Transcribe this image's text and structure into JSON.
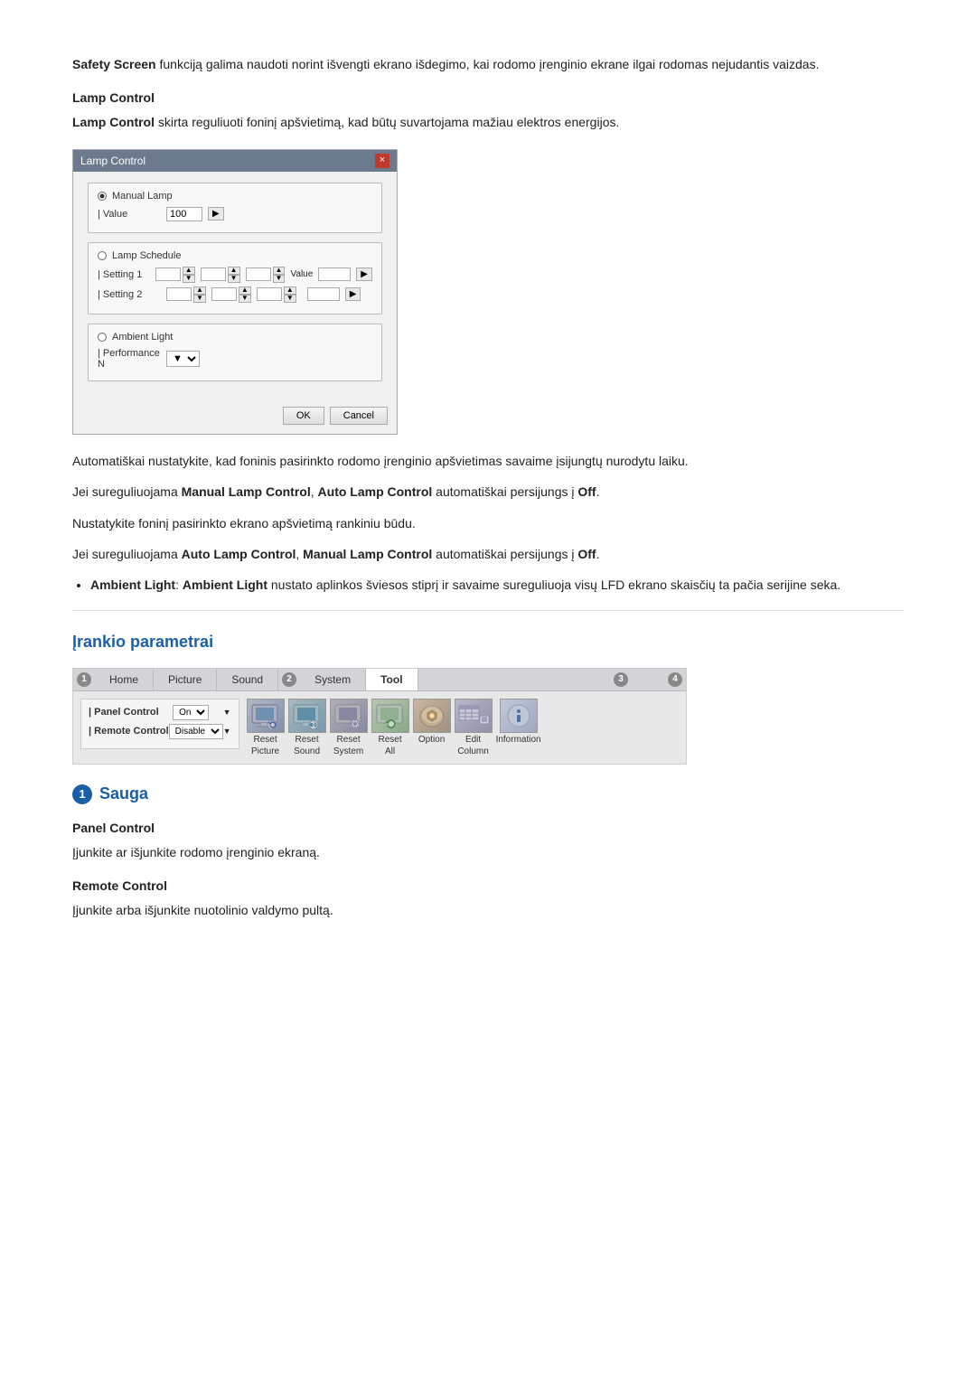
{
  "intro": {
    "safety_screen_text": "Safety Screen",
    "safety_screen_desc": " funkciją galima naudoti norint išvengti ekrano išdegimo, kai rodomo įrenginio ekrane ilgai rodomas nejudantis vaizdas.",
    "lamp_control_heading": "Lamp Control",
    "lamp_control_desc_prefix": "Lamp Control",
    "lamp_control_desc": " skirta reguliuoti foninį apšvietimą, kad būtų suvartojama mažiau elektros energijos."
  },
  "lamp_dialog": {
    "title": "Lamp Control",
    "close_label": "×",
    "manual_lamp_label": "Manual Lamp",
    "value_label": "| Value",
    "value_input": "100",
    "lamp_schedule_label": "Lamp Schedule",
    "setting1_label": "| Setting 1",
    "setting2_label": "| Setting 2",
    "value_col": "Value",
    "ambient_light_label": "Ambient Light",
    "performance_label": "| Performance N",
    "ok_btn": "OK",
    "cancel_btn": "Cancel"
  },
  "paragraphs": {
    "auto1": "Automatiškai nustatykite, kad foninis pasirinkto rodomo įrenginio apšvietimas savaime įsijungtų nurodytu laiku.",
    "jei1": "Jei sureguliuojama ",
    "manual_lamp": "Manual Lamp Control",
    "jei1_mid": ", ",
    "auto_lamp": "Auto Lamp Control",
    "jei1_end": " automatiškai persijungs į ",
    "off": "Off",
    "period": ".",
    "jei2": "Nustatykite foninį pasirinkto ekrano apšvietimą rankiniu būdu.",
    "jei3": "Jei sureguliuojama ",
    "auto_lamp2": "Auto Lamp Control",
    "jei3_mid": ", ",
    "manual_lamp2": "Manual Lamp Control",
    "jei3_end": " automatiškai persijungs į ",
    "off2": "Off",
    "period2": ".",
    "bullet_label": "Ambient Light",
    "bullet_colon": ": ",
    "ambient_light_bold": "Ambient Light",
    "bullet_text": " nustato aplinkos šviesos stiprį ir savaime sureguliuoja visų LFD ekrano skaisčių ta pačia serijine seka."
  },
  "tool_section": {
    "title": "Įrankio parametrai",
    "num": "1",
    "tab_numbers": [
      "1",
      "2",
      "3",
      "4"
    ],
    "tabs": [
      "Home",
      "Picture",
      "Sound",
      "System",
      "Tool"
    ],
    "active_tab": "Tool",
    "left_panel": {
      "rows": [
        {
          "label": "| Panel Control",
          "value": "On"
        },
        {
          "label": "| Remote Control",
          "value": "Disable"
        }
      ]
    },
    "icons": [
      {
        "label_line1": "Reset",
        "label_line2": "Picture",
        "type": "monitor"
      },
      {
        "label_line1": "Reset",
        "label_line2": "Sound",
        "type": "monitor2"
      },
      {
        "label_line1": "Reset",
        "label_line2": "System",
        "type": "gear"
      },
      {
        "label_line1": "Reset",
        "label_line2": "All",
        "type": "arrows"
      },
      {
        "label_line1": "Option",
        "label_line2": "",
        "type": "option"
      },
      {
        "label_line1": "Edit",
        "label_line2": "Column",
        "type": "edit"
      },
      {
        "label_line1": "Information",
        "label_line2": "",
        "type": "info"
      }
    ]
  },
  "sauga_section": {
    "num": "1",
    "title": "Sauga",
    "panel_control_heading": "Panel Control",
    "panel_control_desc": "Įjunkite ar išjunkite rodomo įrenginio ekraną.",
    "remote_control_heading": "Remote Control",
    "remote_control_desc": "Įjunkite arba išjunkite nuotolinio valdymo pultą."
  }
}
